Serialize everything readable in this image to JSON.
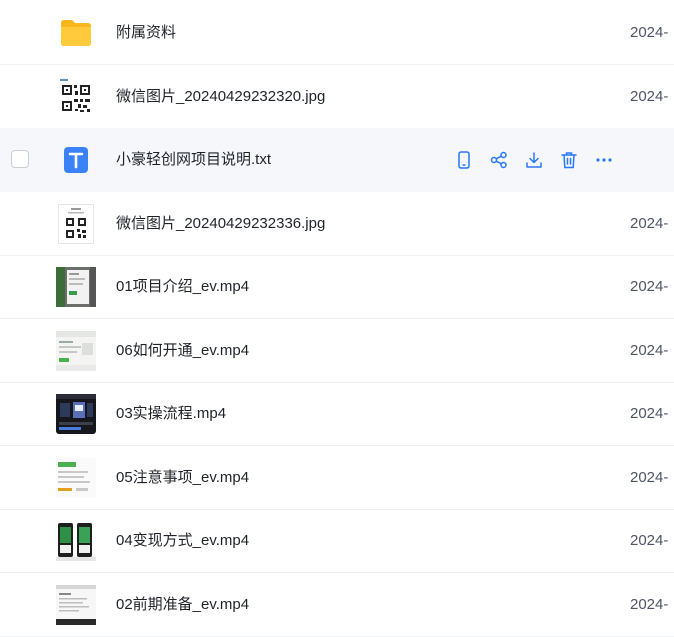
{
  "accent_color": "#2878ff",
  "rows": [
    {
      "name": "附属资料",
      "date": "2024-",
      "type": "folder",
      "icon": "folder-icon"
    },
    {
      "name": "微信图片_20240429232320.jpg",
      "date": "2024-",
      "type": "image",
      "icon": "qr-code-image-thumbnail"
    },
    {
      "name": "小豪轻创网项目说明.txt",
      "date": "",
      "type": "txt",
      "icon": "text-file-icon"
    },
    {
      "name": "微信图片_20240429232336.jpg",
      "date": "2024-",
      "type": "image",
      "icon": "qr-code-image-thumbnail"
    },
    {
      "name": "01项目介绍_ev.mp4",
      "date": "2024-",
      "type": "video",
      "icon": "video-thumbnail"
    },
    {
      "name": "06如何开通_ev.mp4",
      "date": "2024-",
      "type": "video",
      "icon": "video-thumbnail"
    },
    {
      "name": "03实操流程.mp4",
      "date": "2024-",
      "type": "video",
      "icon": "video-thumbnail"
    },
    {
      "name": "05注意事项_ev.mp4",
      "date": "2024-",
      "type": "video",
      "icon": "video-thumbnail"
    },
    {
      "name": "04变现方式_ev.mp4",
      "date": "2024-",
      "type": "video",
      "icon": "video-thumbnail"
    },
    {
      "name": "02前期准备_ev.mp4",
      "date": "2024-",
      "type": "video",
      "icon": "video-thumbnail"
    }
  ],
  "hover_actions": [
    "phone-icon",
    "share-icon",
    "download-icon",
    "delete-icon",
    "more-icon"
  ]
}
